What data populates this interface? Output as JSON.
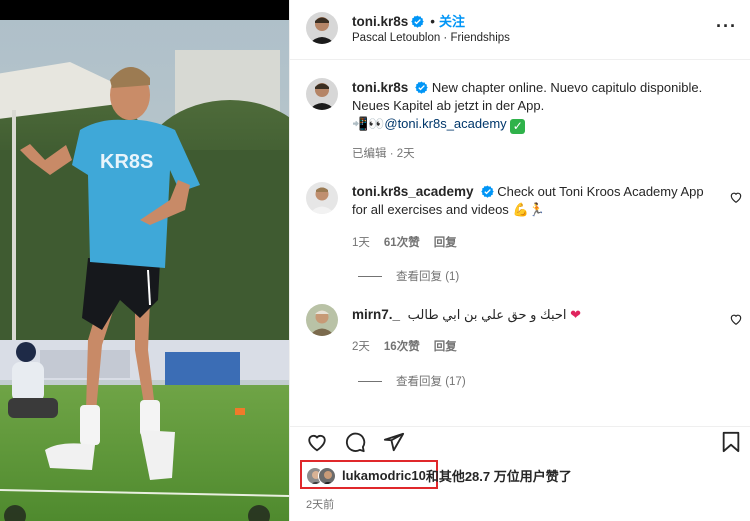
{
  "post": {
    "author": "toni.kr8s",
    "follow_label": "关注",
    "separator": "•",
    "subtitle": "Pascal Letoublon · Friendships",
    "more_label": "···"
  },
  "caption": {
    "author": "toni.kr8s",
    "line1": "New chapter online. Nuevo capitulo disponible.",
    "line2": "Neues Kapitel ab jetzt in der App.",
    "emoji_prefix": "📲👀",
    "mention": "@toni.kr8s_academy",
    "emoji_suffix": "✓",
    "meta": "已编辑 · 2天"
  },
  "comments": [
    {
      "author": "toni.kr8s_academy",
      "text": "Check out Toni Kroos Academy App for all exercises and videos",
      "emoji": "💪🏃",
      "time": "1天",
      "likes": "61次赞",
      "reply_label": "回复",
      "view_replies": "查看回复 (1)"
    },
    {
      "author": "mirn7._",
      "text": "احبك و حق علي بن ابي طالب",
      "emoji": "❤",
      "time": "2天",
      "likes": "16次赞",
      "reply_label": "回复",
      "view_replies": "查看回复 (17)"
    }
  ],
  "likes_summary": {
    "user": "lukamodric10",
    "rest": "和其他28.7 万位用户赞了"
  },
  "posted_ago": "2天前",
  "icons": {
    "verified": "verified-badge-icon",
    "like": "heart-icon",
    "comment": "comment-icon",
    "share": "paper-plane-icon",
    "save": "bookmark-icon"
  },
  "colors": {
    "accent": "#0095f6",
    "verified": "#0095f6",
    "highlight_box": "#e0282b",
    "pitch": "#5f9a3a",
    "shirt": "#3fa8d8"
  }
}
